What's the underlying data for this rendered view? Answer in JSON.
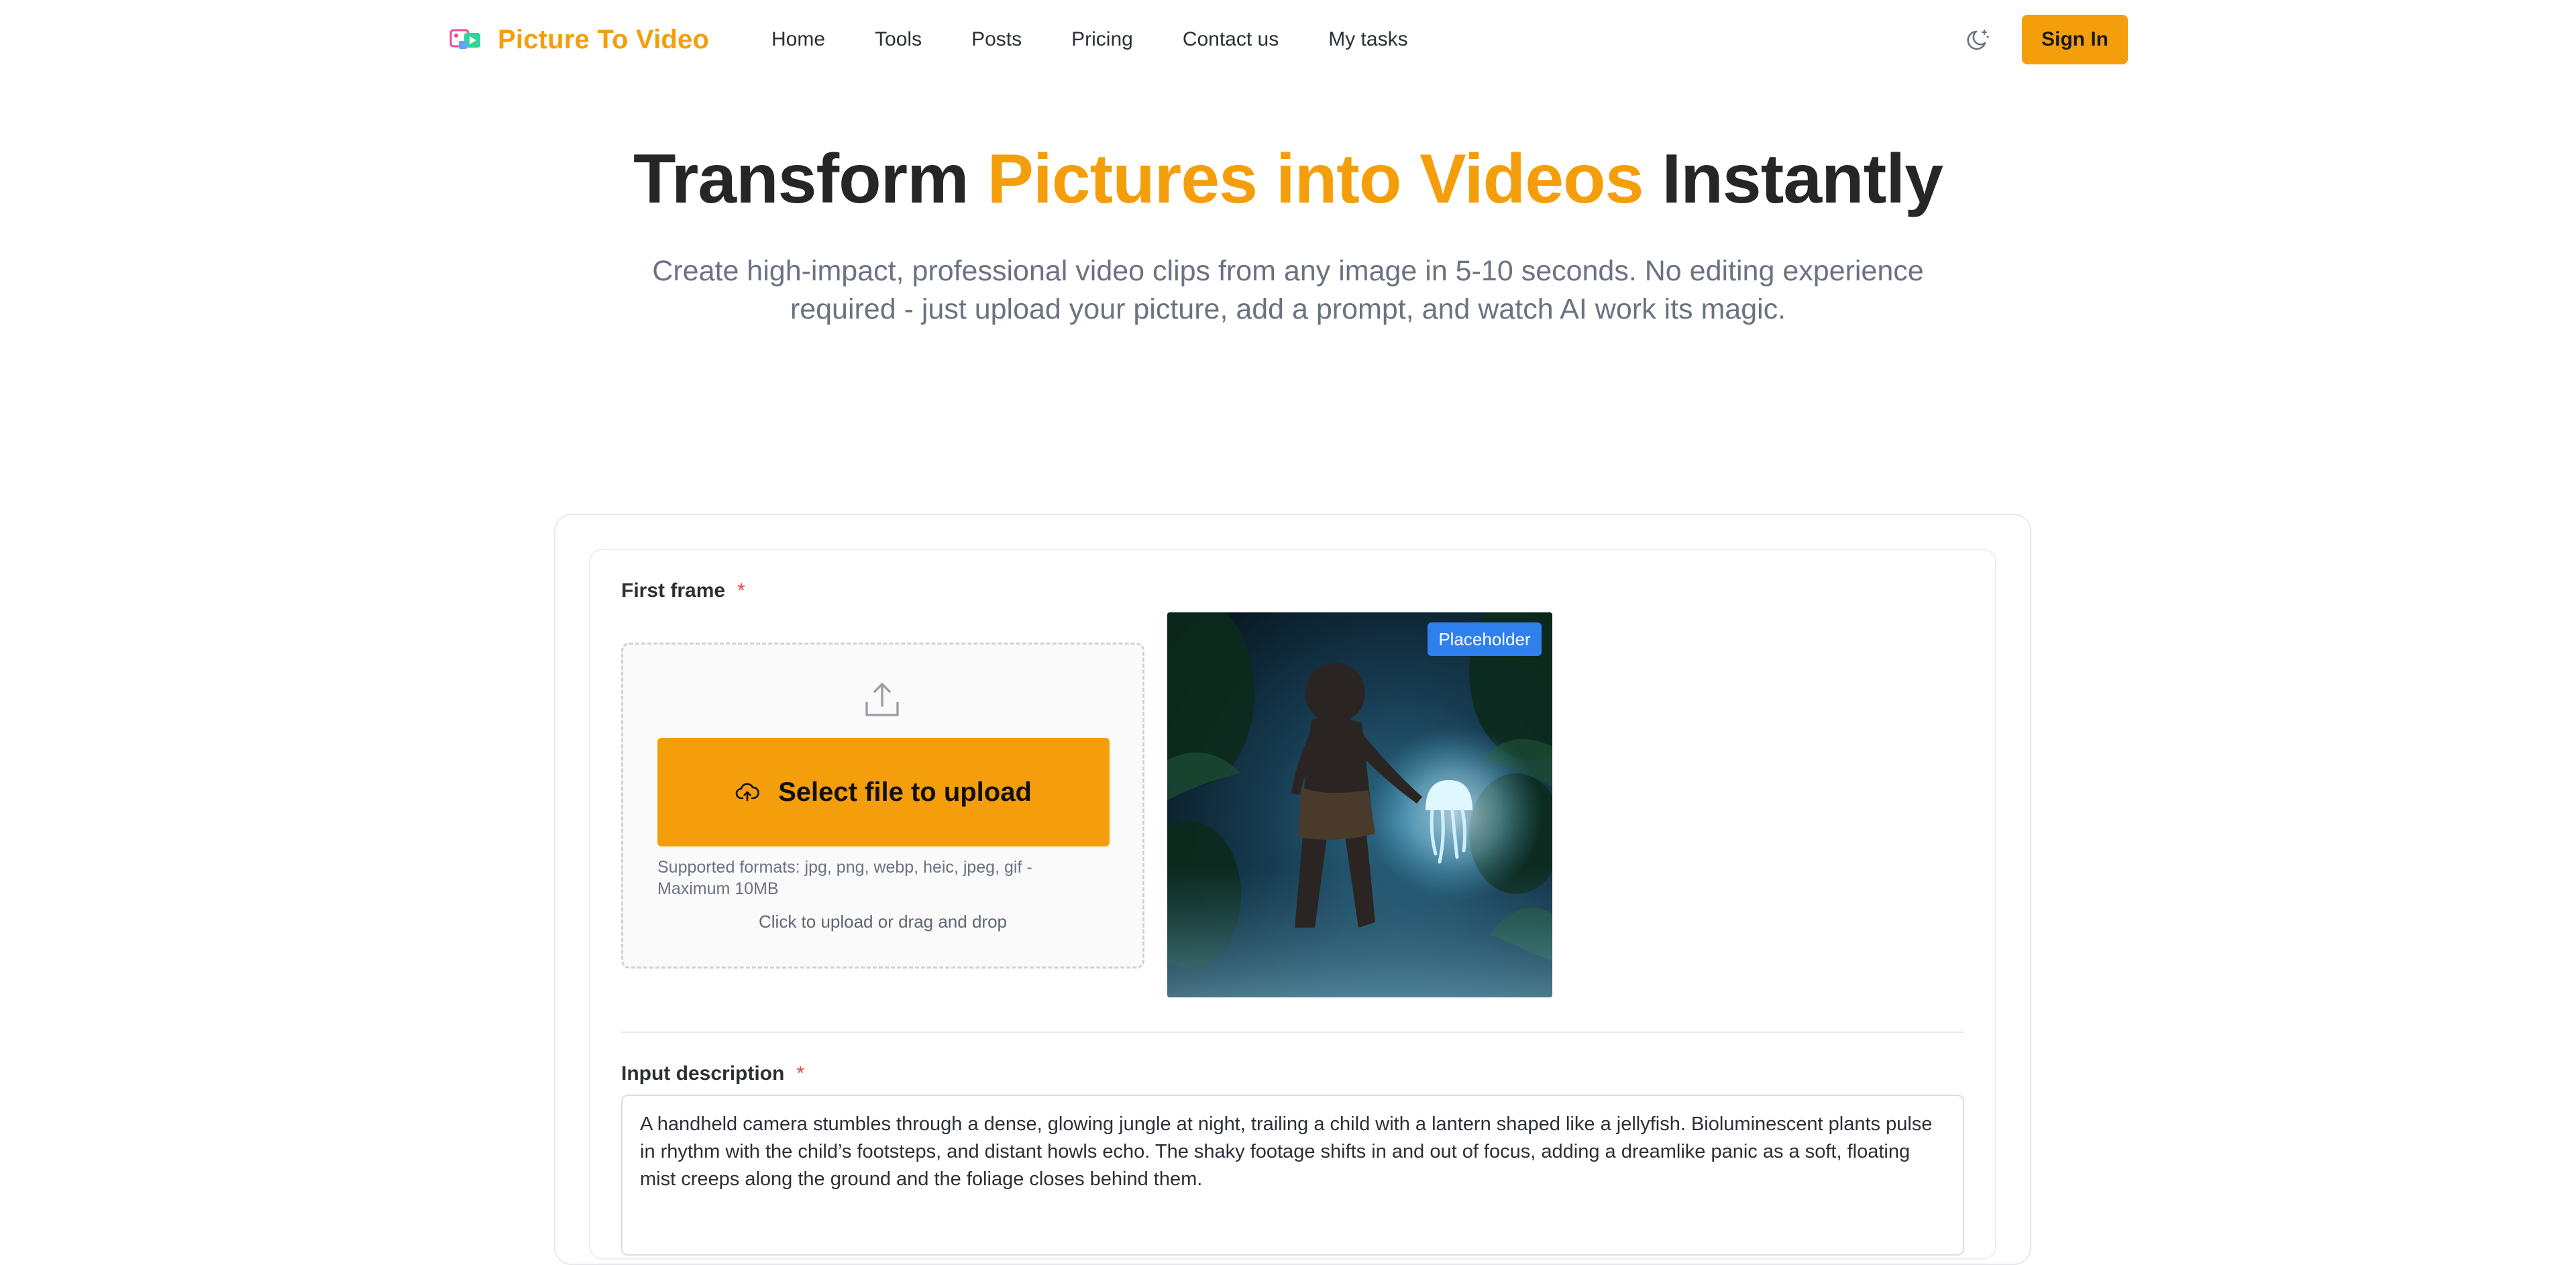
{
  "header": {
    "brand": "Picture To Video",
    "nav": [
      "Home",
      "Tools",
      "Posts",
      "Pricing",
      "Contact us",
      "My tasks"
    ],
    "sign_in": "Sign In"
  },
  "hero": {
    "title_lead": "Transform ",
    "title_accent": "Pictures into Videos",
    "title_tail": " Instantly",
    "subtitle": "Create high-impact, professional video clips from any image in 5-10 seconds. No editing experience required - just upload your picture, add a prompt, and watch AI work its magic."
  },
  "form": {
    "first_frame_label": "First frame",
    "required_mark": "*",
    "upload_button": "Select file to upload",
    "formats_note": "Supported formats: jpg, png, webp, heic, jpeg, gif - Maximum 10MB",
    "drop_hint": "Click to upload or drag and drop",
    "preview_badge": "Placeholder",
    "description_label": "Input description",
    "description_value": "A handheld camera stumbles through a dense, glowing jungle at night, trailing a child with a lantern shaped like a jellyfish. Bioluminescent plants pulse in rhythm with the child’s footsteps, and distant howls echo. The shaky footage shifts in and out of focus, adding a dreamlike panic as a soft, floating mist creeps along the ground and the foliage closes behind them."
  },
  "colors": {
    "accent": "#f59e0b",
    "badge": "#2f80ed",
    "required": "#ef4444"
  },
  "icons": {
    "logo": "picture-to-video-logo-icon",
    "theme": "moon-stars-icon",
    "upload": "upload-tray-icon",
    "cloud": "cloud-upload-icon"
  }
}
